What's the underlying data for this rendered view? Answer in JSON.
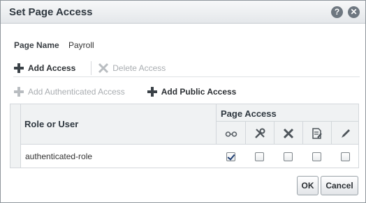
{
  "dialog": {
    "title": "Set Page Access",
    "help_label": "?",
    "close_label": "✕"
  },
  "page": {
    "name_label": "Page Name",
    "name_value": "Payroll"
  },
  "toolbar": {
    "add_access": "Add Access",
    "delete_access": "Delete Access",
    "add_authenticated_access": "Add Authenticated Access",
    "add_public_access": "Add Public Access"
  },
  "table": {
    "role_header": "Role or User",
    "access_header": "Page Access",
    "access_icons": [
      "view-icon",
      "administer-icon",
      "delete-icon",
      "edit-icon",
      "customize-icon"
    ],
    "rows": [
      {
        "role": "authenticated-role",
        "permissions": [
          true,
          false,
          false,
          false,
          false
        ]
      }
    ]
  },
  "footer": {
    "ok_label": "OK",
    "cancel_label": "Cancel"
  }
}
